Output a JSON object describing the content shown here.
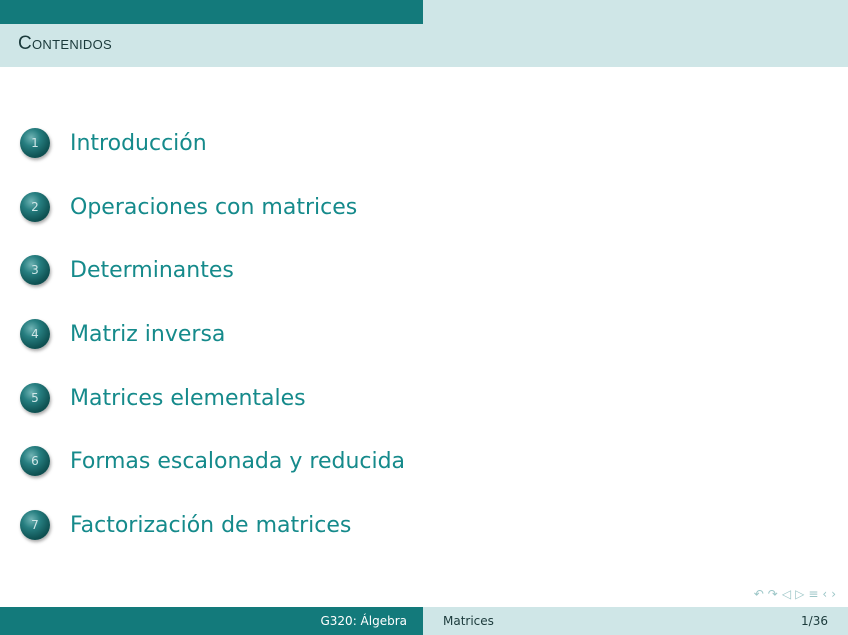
{
  "header": {
    "title": "Contenidos"
  },
  "toc": [
    {
      "number": "1",
      "label": "Introducción"
    },
    {
      "number": "2",
      "label": "Operaciones con matrices"
    },
    {
      "number": "3",
      "label": "Determinantes"
    },
    {
      "number": "4",
      "label": "Matriz inversa"
    },
    {
      "number": "5",
      "label": "Matrices elementales"
    },
    {
      "number": "6",
      "label": "Formas escalonada y reducida"
    },
    {
      "number": "7",
      "label": "Factorización de matrices"
    }
  ],
  "footer": {
    "course": "G320: Álgebra",
    "topic": "Matrices",
    "page": "1/36"
  },
  "navigation": {
    "symbols": [
      "↶",
      "↷",
      "◁",
      "▷",
      "≡",
      "‹",
      "›"
    ]
  },
  "colors": {
    "theme_dark": "#137a7b",
    "theme_light": "#cfe6e7",
    "link": "#158a8b"
  }
}
